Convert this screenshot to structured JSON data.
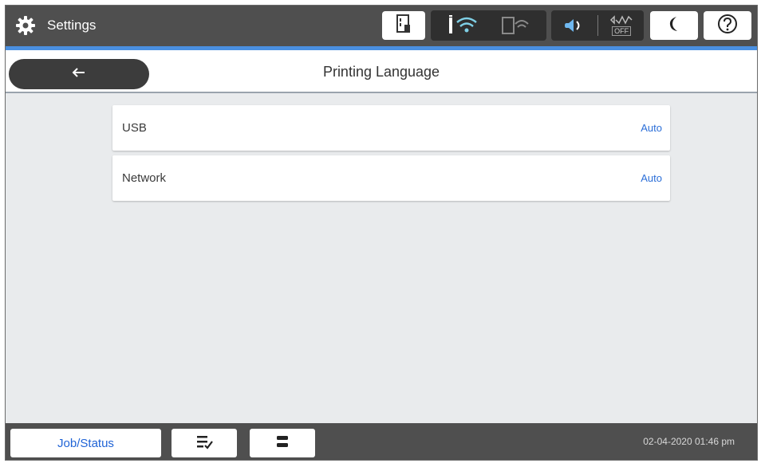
{
  "status_bar": {
    "title": "Settings",
    "icons": {
      "settings": "gear-icon",
      "ink": "ink-cartridge-icon",
      "wifi": "wifi-icon",
      "wifi_direct": "wifi-direct-icon",
      "sound": "speaker-icon",
      "fax": "fax-off-icon",
      "sleep": "moon-icon",
      "help": "help-icon"
    },
    "fax_off_label": "OFF",
    "colors": {
      "bar": "#4f4f4f",
      "accent_rule": "#4a8fe0"
    }
  },
  "title_bar": {
    "back_icon": "arrow-left-icon",
    "title": "Printing Language"
  },
  "list": {
    "items": [
      {
        "label": "USB",
        "value": "Auto"
      },
      {
        "label": "Network",
        "value": "Auto"
      }
    ],
    "value_color": "#2c6fd8"
  },
  "bottom_bar": {
    "job_status_label": "Job/Status",
    "icons": {
      "job_list": "job-list-icon",
      "print_queue": "print-queue-icon"
    },
    "datetime": "02-04-2020 01:46 pm"
  }
}
